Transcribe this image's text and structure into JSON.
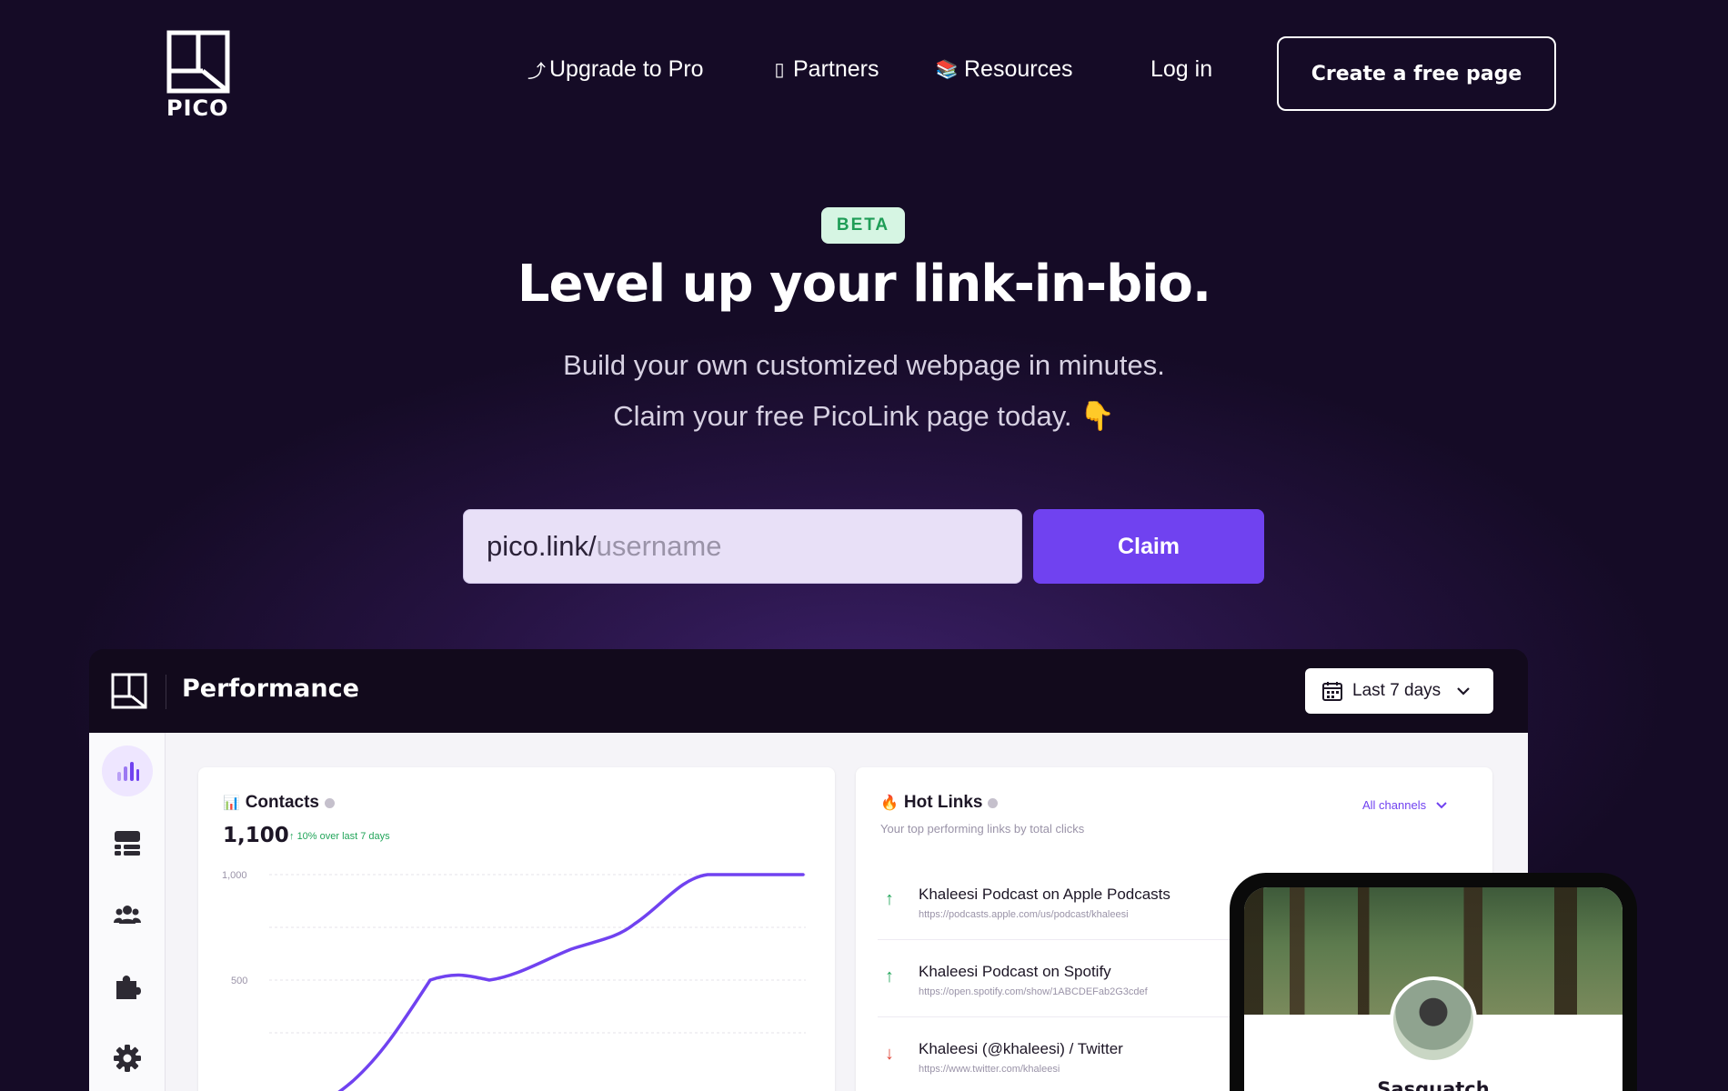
{
  "brand": {
    "logo_text": "PICO"
  },
  "nav": {
    "items": [
      {
        "label": "Upgrade to Pro",
        "icon": "⤴"
      },
      {
        "label": "Partners",
        "icon": "▯"
      },
      {
        "label": "Resources",
        "icon": "📚"
      },
      {
        "label": "Log in"
      }
    ],
    "cta_label": "Create a free page"
  },
  "hero": {
    "badge": "BETA",
    "title": "Level up your link-in-bio.",
    "subtitle_line1": "Build your own customized webpage in minutes.",
    "subtitle_line2": "Claim your free PicoLink page today. 👇",
    "input_prefix": "pico.link/",
    "input_placeholder": "username",
    "claim_label": "Claim"
  },
  "dashboard": {
    "title": "Performance",
    "range_label": "Last 7 days",
    "contacts": {
      "title": "Contacts",
      "icon": "📊",
      "total": "1,100",
      "trend_label": "10% over last 7 days",
      "y_ticks": [
        "1,000",
        "500"
      ]
    },
    "hot_links": {
      "title": "Hot Links",
      "icon": "🔥",
      "subtitle": "Your top performing links by total clicks",
      "filter_label": "All channels",
      "items": [
        {
          "title": "Khaleesi Podcast on Apple Podcasts",
          "url": "https://podcasts.apple.com/us/podcast/khaleesi",
          "direction": "up"
        },
        {
          "title": "Khaleesi Podcast on Spotify",
          "url": "https://open.spotify.com/show/1ABCDEFab2G3cdef",
          "direction": "up"
        },
        {
          "title": "Khaleesi (@khaleesi)  / Twitter",
          "url": "https://www.twitter.com/khaleesi",
          "direction": "down"
        }
      ]
    },
    "profile": {
      "name": "Sasquatch"
    }
  },
  "colors": {
    "accent": "#7042f0",
    "up": "#22a55a",
    "down": "#e0483c",
    "badge_bg": "#d6f5e3"
  }
}
